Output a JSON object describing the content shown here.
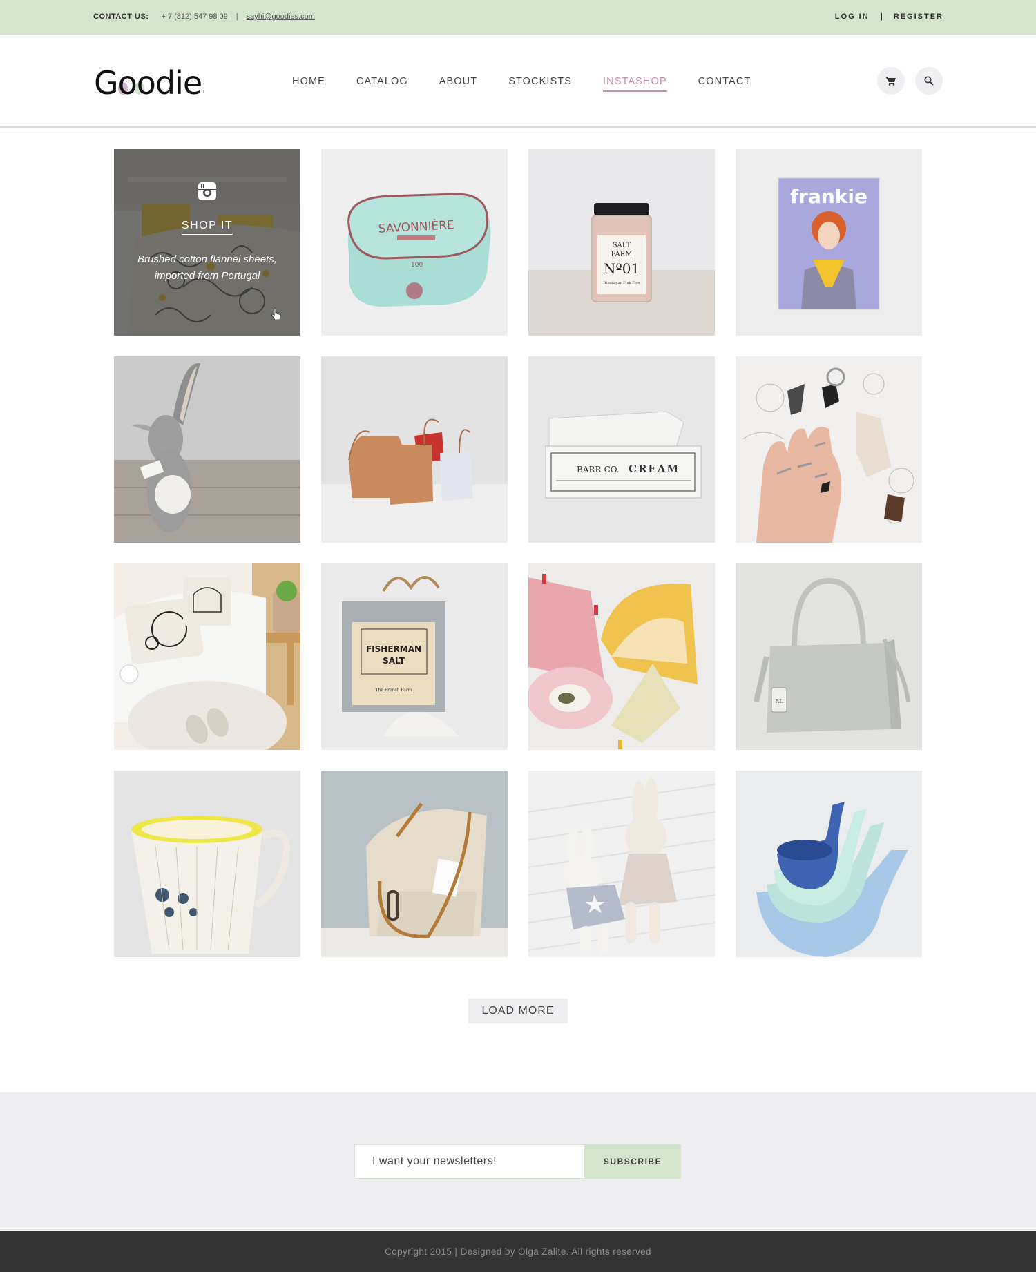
{
  "topbar": {
    "contact_label": "CONTACT US:",
    "phone": "+ 7 (812) 547 98 09",
    "separator": "|",
    "email": "sayhi@goodies.com",
    "login": "LOG IN",
    "auth_separator": "|",
    "register": "REGISTER",
    "background_color": "#d4e5cd"
  },
  "header": {
    "logo_text": "Goodies",
    "nav": [
      {
        "label": "HOME",
        "active": false
      },
      {
        "label": "CATALOG",
        "active": false
      },
      {
        "label": "ABOUT",
        "active": false
      },
      {
        "label": "STOCKISTS",
        "active": false
      },
      {
        "label": "INSTASHOP",
        "active": true
      },
      {
        "label": "CONTACT",
        "active": false
      }
    ],
    "icons": [
      "cart-icon",
      "search-icon"
    ],
    "accent_color": "#c88cb4"
  },
  "grid": {
    "hover_tile": {
      "icon": "instagram-icon",
      "cta": "SHOP IT",
      "description_line1": "Brushed cotton flannel sheets,",
      "description_line2": "imported from Portugal"
    },
    "items": [
      {
        "subject": "Paisley flannel bedding"
      },
      {
        "subject": "Savonnière soap tin",
        "label": "SAVONNIÈRE"
      },
      {
        "subject": "Salt Farm jar",
        "label": "SALT FARM Nº01"
      },
      {
        "subject": "frankie magazine",
        "label": "frankie"
      },
      {
        "subject": "Felt bunny toy"
      },
      {
        "subject": "Leather bucket bags"
      },
      {
        "subject": "Barr-Co. hand cream",
        "label": "BARR-CO. CREAM"
      },
      {
        "subject": "Rings and crystals"
      },
      {
        "subject": "Sofa with cushions"
      },
      {
        "subject": "Fisherman salt box",
        "label": "FISHERMAN SALT"
      },
      {
        "subject": "Fan-shaped tea packaging"
      },
      {
        "subject": "Grey leather handbag"
      },
      {
        "subject": "Floral porcelain mug"
      },
      {
        "subject": "Canvas tote bag"
      },
      {
        "subject": "Knitted bunny toys"
      },
      {
        "subject": "Whale nesting bowls"
      }
    ]
  },
  "load_more": "LOAD MORE",
  "newsletter": {
    "input_value": "I want your newsletters!",
    "button": "SUBSCRIBE"
  },
  "footer": {
    "text": "Copyright 2015 | Designed by Olga Zalite. All rights reserved"
  }
}
